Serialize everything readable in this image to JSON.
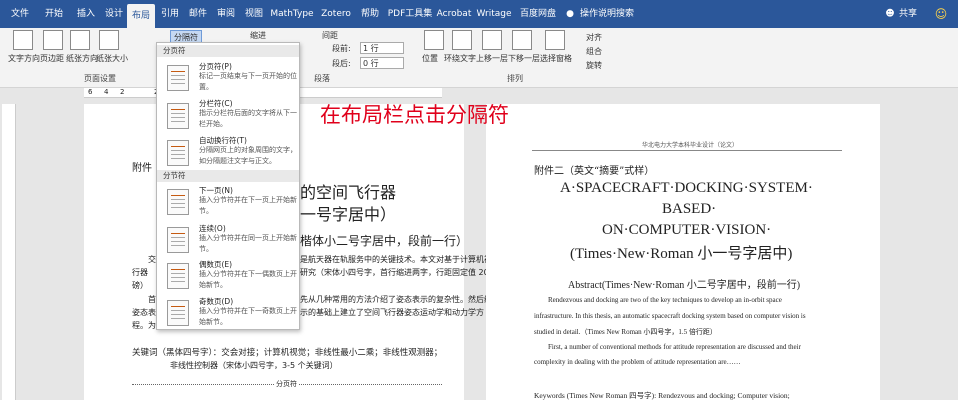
{
  "tabs": [
    "文件",
    "开始",
    "插入",
    "设计",
    "布局",
    "引用",
    "邮件",
    "审阅",
    "视图",
    "MathType",
    "Zotero",
    "帮助",
    "PDF工具集",
    "Acrobat",
    "Writage",
    "百度网盘"
  ],
  "active_tab": "布局",
  "search_placeholder": "操作说明搜索",
  "share_label": "共享",
  "ribbon": {
    "page_setup_buttons": [
      "文字方向",
      "页边距",
      "纸张方向",
      "纸张大小"
    ],
    "page_setup_label": "页面设置",
    "breaks_button": "分隔符",
    "indent_label": "缩进",
    "spacing_label": "间距",
    "before_label": "段前:",
    "before_value": "1 行",
    "after_label": "段后:",
    "after_value": "0 行",
    "paragraph_label": "段落",
    "arrange_buttons": [
      "位置",
      "环绕文字",
      "上移一层",
      "下移一层",
      "选择窗格"
    ],
    "align_label": "对齐",
    "group_label": "组合",
    "rotate_label": "旋转",
    "arrange_label": "排列"
  },
  "ruler_numbers": [
    "6",
    "4",
    "2",
    "",
    "2",
    "4",
    "6",
    "8",
    "10",
    "12",
    "14",
    "16"
  ],
  "menu": {
    "section_page": "分页符",
    "section_section": "分节符",
    "items": [
      {
        "title": "分页符(P)",
        "desc": "标记一页结束与下一页开始的位置。"
      },
      {
        "title": "分栏符(C)",
        "desc": "指示分栏符后面的文字将从下一栏开始。"
      },
      {
        "title": "自动换行符(T)",
        "desc": "分隔网页上的对象周围的文字，如分隔题注文字与正文。"
      },
      {
        "title": "下一页(N)",
        "desc": "插入分节符并在下一页上开始新节。"
      },
      {
        "title": "连续(O)",
        "desc": "插入分节符并在同一页上开始新节。"
      },
      {
        "title": "偶数页(E)",
        "desc": "插入分节符并在下一偶数页上开始新节。"
      },
      {
        "title": "奇数页(D)",
        "desc": "插入分节符并在下一奇数页上开始新节。"
      }
    ]
  },
  "caption": "在布局栏点击分隔符",
  "left_page": {
    "appendix": "附件",
    "title1": "的空间飞行器",
    "title2": "一号字居中）",
    "subtitle": "楷体小二号字居中，段前一行）",
    "para1a": "交",
    "para1b": "是航天器在轨服务中的关键技术。本文对基于计算机视觉的空间飞",
    "para1c": "行器",
    "para1d": "研究（宋体小四号字，首行缩进两字，行距固定值 20",
    "para1e": "磅）",
    "para2a": "首",
    "para2b": "先从几种常用的方法介绍了姿态表示的复杂性。然后给出了代数法",
    "para2c": "姿态表",
    "para2d": "示的基础上建立了空间飞行器姿态运动学和动力学方",
    "para2e": "程。为",
    "keywords": "关键词（黑体四号字）：交会对接；计算机视觉；非线性最小二乘；非线性观测器；",
    "keywords2": "非线性控制器（宋体小四号字，3-5 个关键词）",
    "break_marker": "分页符"
  },
  "right_page": {
    "header": "华北电力大学本科毕业设计（论文）",
    "appendix": "附件二（英文“摘要”式样）",
    "title1": "A·SPACECRAFT·DOCKING·SYSTEM·",
    "title2": "BASED·",
    "title3": "ON·COMPUTER·VISION·",
    "title4": "(Times·New·Roman 小一号字居中)",
    "abstract": "Abstract(Times·New·Roman 小二号字居中，段前一行)",
    "para1": "Rendezvous and docking are two of the key techniques to develop an in-orbit space",
    "para2": "infrastructure. In this thesis, an automatic spacecraft docking system based on computer vision is",
    "para3": "studied in detail.（Times New Roman 小四号字，1.5 倍行距）",
    "para4": "First, a number of conventional methods for attitude representation are discussed and their",
    "para5": "complexity in dealing with the problem of attitude representation are……",
    "keywords": "Keywords (Times New Roman 四号字): Rendezvous and docking; Computer vision;"
  }
}
